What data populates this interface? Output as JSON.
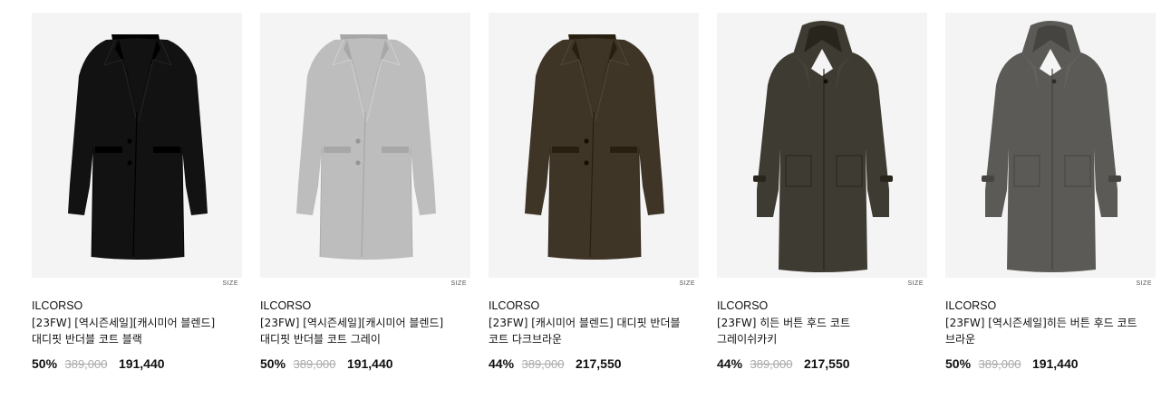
{
  "products": [
    {
      "brand": "ILCORSO",
      "title": "[23FW] [역시즌세일][캐시미어 블렌드] 대디핏 반더블 코트 블랙",
      "discount": "50%",
      "original_price": "389,000",
      "sale_price": "191,440",
      "size_label": "SIZE",
      "coat_color": "#121212",
      "coat_style": "double",
      "icon": "coat-image"
    },
    {
      "brand": "ILCORSO",
      "title": "[23FW] [역시즌세일][캐시미어 블렌드] 대디핏 반더블 코트 그레이",
      "discount": "50%",
      "original_price": "389,000",
      "sale_price": "191,440",
      "size_label": "SIZE",
      "coat_color": "#bdbdbd",
      "coat_style": "double",
      "icon": "coat-image"
    },
    {
      "brand": "ILCORSO",
      "title": "[23FW] [캐시미어 블렌드] 대디핏 반더블 코트 다크브라운",
      "discount": "44%",
      "original_price": "389,000",
      "sale_price": "217,550",
      "size_label": "SIZE",
      "coat_color": "#3f3527",
      "coat_style": "double",
      "icon": "coat-image"
    },
    {
      "brand": "ILCORSO",
      "title": "[23FW] 히든 버튼 후드 코트 그레이쉬카키",
      "discount": "44%",
      "original_price": "389,000",
      "sale_price": "217,550",
      "size_label": "SIZE",
      "coat_color": "#3e3b32",
      "coat_style": "hood",
      "icon": "coat-image"
    },
    {
      "brand": "ILCORSO",
      "title": "[23FW] [역시즌세일]히든 버튼 후드 코트 브라운",
      "discount": "50%",
      "original_price": "389,000",
      "sale_price": "191,440",
      "size_label": "SIZE",
      "coat_color": "#5c5a56",
      "coat_style": "hood",
      "icon": "coat-image"
    }
  ]
}
